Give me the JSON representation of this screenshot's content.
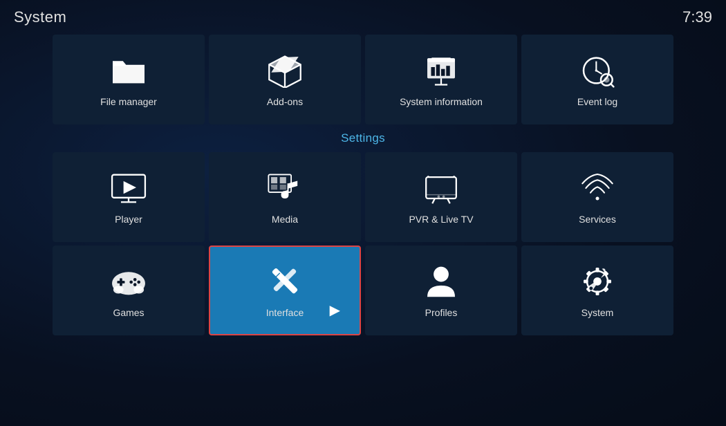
{
  "header": {
    "title": "System",
    "time": "7:39"
  },
  "topRow": [
    {
      "id": "file-manager",
      "label": "File manager",
      "icon": "folder"
    },
    {
      "id": "add-ons",
      "label": "Add-ons",
      "icon": "addons"
    },
    {
      "id": "system-information",
      "label": "System information",
      "icon": "sysinfo"
    },
    {
      "id": "event-log",
      "label": "Event log",
      "icon": "eventlog"
    }
  ],
  "sectionLabel": "Settings",
  "settingsRow1": [
    {
      "id": "player",
      "label": "Player",
      "icon": "player"
    },
    {
      "id": "media",
      "label": "Media",
      "icon": "media"
    },
    {
      "id": "pvr-live-tv",
      "label": "PVR & Live TV",
      "icon": "pvr"
    },
    {
      "id": "services",
      "label": "Services",
      "icon": "services"
    }
  ],
  "settingsRow2": [
    {
      "id": "games",
      "label": "Games",
      "icon": "games"
    },
    {
      "id": "interface",
      "label": "Interface",
      "icon": "interface",
      "active": true
    },
    {
      "id": "profiles",
      "label": "Profiles",
      "icon": "profiles"
    },
    {
      "id": "system",
      "label": "System",
      "icon": "systemsettings"
    }
  ]
}
